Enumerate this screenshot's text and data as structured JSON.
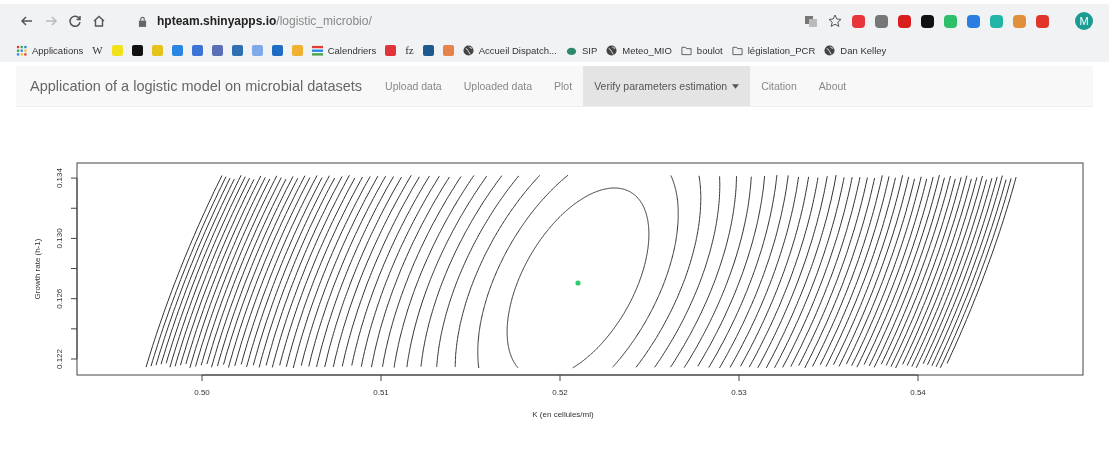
{
  "browser": {
    "url_host": "hpteam.shinyapps.io",
    "url_path": "/logistic_microbio/",
    "profile_initial": "M",
    "extensions": [
      {
        "color": "#e8343b"
      },
      {
        "color": "#777777"
      },
      {
        "color": "#d91e1e"
      },
      {
        "color": "#111111"
      },
      {
        "color": "#2dbf6a"
      },
      {
        "color": "#2a7de1"
      },
      {
        "color": "#22b5a5"
      },
      {
        "color": "#e0903a"
      },
      {
        "color": "#e0352b"
      }
    ]
  },
  "bookmarks": [
    {
      "kind": "apps",
      "label": "Applications"
    },
    {
      "kind": "text",
      "label": "W"
    },
    {
      "kind": "icon",
      "color": "#f2e21b"
    },
    {
      "kind": "icon",
      "color": "#111111"
    },
    {
      "kind": "icon",
      "color": "#e6c31a"
    },
    {
      "kind": "icon",
      "color": "#2a86e0"
    },
    {
      "kind": "icon",
      "color": "#3b74d6"
    },
    {
      "kind": "icon",
      "color": "#5b6fb8"
    },
    {
      "kind": "icon",
      "color": "#2d6fb0"
    },
    {
      "kind": "icon",
      "color": "#7fa9e8"
    },
    {
      "kind": "icon",
      "color": "#1f6cc4"
    },
    {
      "kind": "icon",
      "color": "#f0b030"
    },
    {
      "kind": "calendar",
      "label": "Calendriers"
    },
    {
      "kind": "icon",
      "color": "#e2333b"
    },
    {
      "kind": "text",
      "label": "fz"
    },
    {
      "kind": "icon",
      "color": "#1d5b8f"
    },
    {
      "kind": "icon",
      "color": "#e8824a"
    },
    {
      "kind": "globe",
      "label": "Accueil Dispatch..."
    },
    {
      "kind": "dot",
      "label": "SIP"
    },
    {
      "kind": "globe",
      "label": "Meteo_MIO"
    },
    {
      "kind": "folder",
      "label": "boulot"
    },
    {
      "kind": "folder",
      "label": "législation_PCR"
    },
    {
      "kind": "globe",
      "label": "Dan Kelley"
    }
  ],
  "navbar": {
    "title": "Application of a logistic model on microbial datasets",
    "tabs": [
      {
        "label": "Upload data",
        "selected": false,
        "dropdown": false
      },
      {
        "label": "Uploaded data",
        "selected": false,
        "dropdown": false
      },
      {
        "label": "Plot",
        "selected": false,
        "dropdown": false
      },
      {
        "label": "Verify parameters estimation",
        "selected": true,
        "dropdown": true
      },
      {
        "label": "Citation",
        "selected": false,
        "dropdown": false
      },
      {
        "label": "About",
        "selected": false,
        "dropdown": false
      }
    ]
  },
  "plot": {
    "xlabel": "K (en cellules/ml)",
    "ylabel": "Growth rate (h-1)",
    "xticks": [
      "0.50",
      "0.51",
      "0.52",
      "0.53",
      "0.54"
    ],
    "yticks": [
      "0.122",
      "0.126",
      "0.130",
      "0.134"
    ]
  }
}
